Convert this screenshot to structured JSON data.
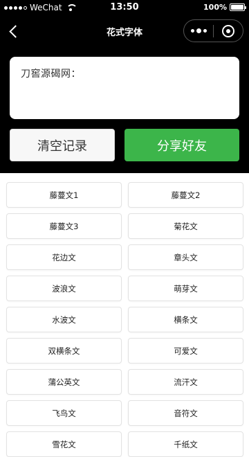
{
  "status_bar": {
    "carrier": "WeChat",
    "time": "13:50",
    "battery": "100%",
    "battery_level": 1.0
  },
  "nav": {
    "title": "花式字体"
  },
  "input": {
    "value": "刀窖源碣网："
  },
  "buttons": {
    "clear_label": "清空记录",
    "share_label": "分享好友"
  },
  "colors": {
    "accent": "#3cb54a",
    "header_bg": "#000000"
  },
  "font_styles": [
    {
      "label": "藤蔓文1"
    },
    {
      "label": "藤蔓文2"
    },
    {
      "label": "藤蔓文3"
    },
    {
      "label": "菊花文"
    },
    {
      "label": "花边文"
    },
    {
      "label": "章头文"
    },
    {
      "label": "波浪文"
    },
    {
      "label": "萌芽文"
    },
    {
      "label": "水波文"
    },
    {
      "label": "横条文"
    },
    {
      "label": "双横条文"
    },
    {
      "label": "可爱文"
    },
    {
      "label": "蒲公英文"
    },
    {
      "label": "流汗文"
    },
    {
      "label": "飞鸟文"
    },
    {
      "label": "音符文"
    },
    {
      "label": "雪花文"
    },
    {
      "label": "千纸文"
    }
  ]
}
